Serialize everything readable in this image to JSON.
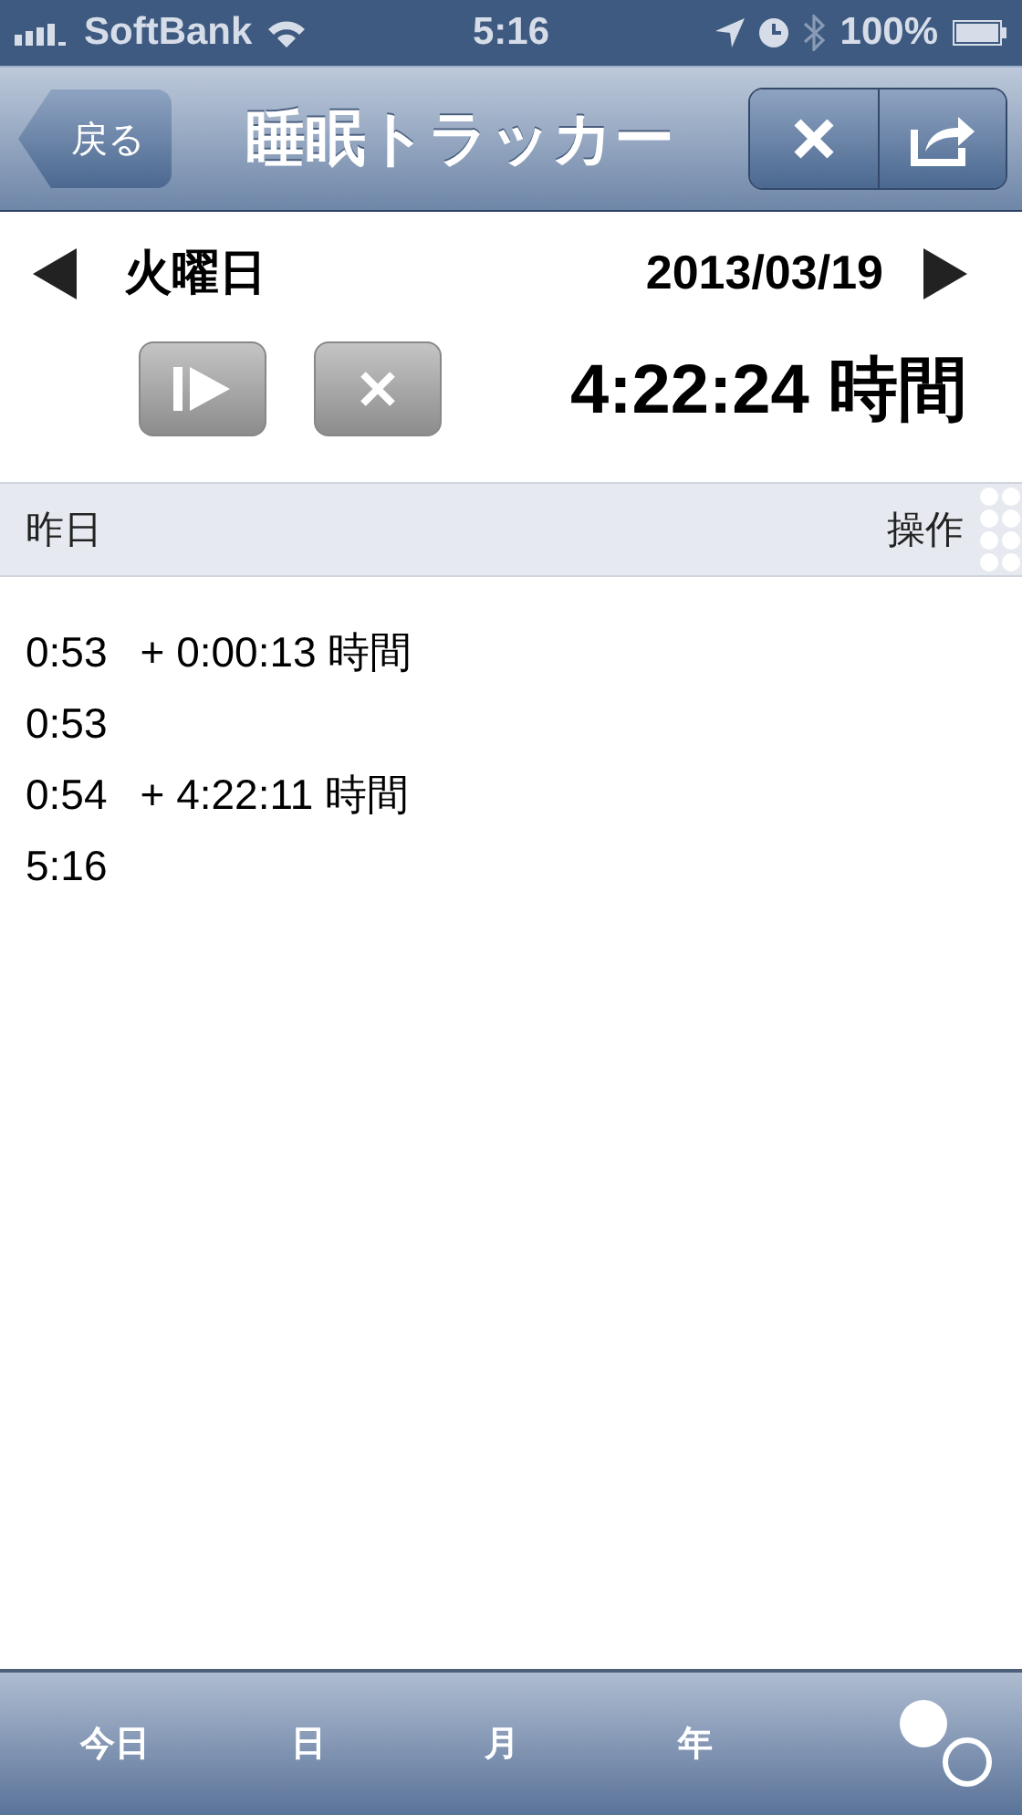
{
  "status_bar": {
    "carrier": "SoftBank",
    "time": "5:16",
    "battery": "100%"
  },
  "nav_bar": {
    "back": "戻る",
    "title": "睡眠トラッカー"
  },
  "day": {
    "weekday": "火曜日",
    "date": "2013/03/19",
    "total": "4:22:24 時間"
  },
  "section": {
    "label": "昨日",
    "action": "操作"
  },
  "entries": [
    {
      "time": "0:53",
      "duration": "+ 0:00:13 時間"
    },
    {
      "time": "0:53"
    },
    {
      "time": "0:54",
      "duration": "+ 4:22:11 時間"
    },
    {
      "time": "5:16"
    }
  ],
  "toolbar": [
    {
      "label": "今日"
    },
    {
      "label": "日"
    },
    {
      "label": "月"
    },
    {
      "label": "年"
    }
  ]
}
